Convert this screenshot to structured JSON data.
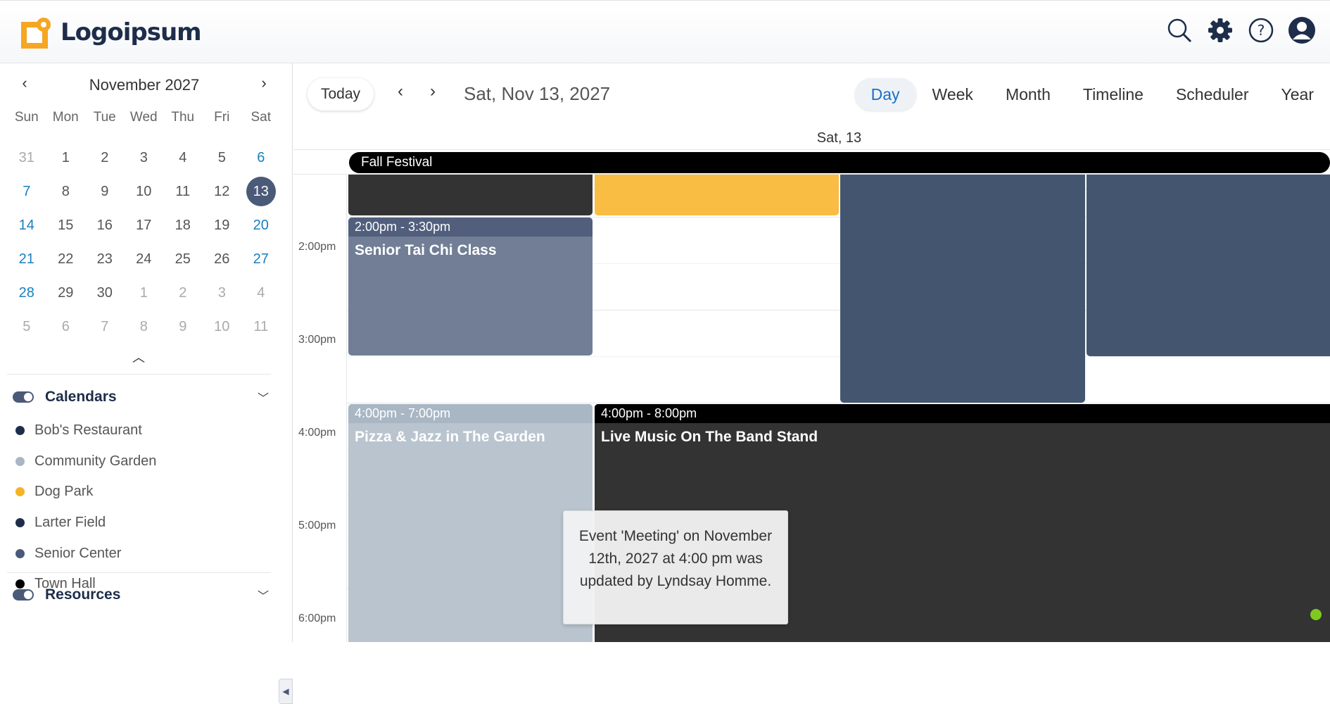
{
  "header": {
    "logo_text": "Logoipsum",
    "icons": [
      "search-icon",
      "gear-icon",
      "help-icon",
      "user-avatar-icon"
    ]
  },
  "mini_calendar": {
    "month_title": "November 2027",
    "weekdays": [
      "Sun",
      "Mon",
      "Tue",
      "Wed",
      "Thu",
      "Fri",
      "Sat"
    ],
    "days": [
      [
        "31",
        "1",
        "2",
        "3",
        "4",
        "5",
        "6"
      ],
      [
        "7",
        "8",
        "9",
        "10",
        "11",
        "12",
        "13"
      ],
      [
        "14",
        "15",
        "16",
        "17",
        "18",
        "19",
        "20"
      ],
      [
        "21",
        "22",
        "23",
        "24",
        "25",
        "26",
        "27"
      ],
      [
        "28",
        "29",
        "30",
        "1",
        "2",
        "3",
        "4"
      ],
      [
        "5",
        "6",
        "7",
        "8",
        "9",
        "10",
        "11"
      ]
    ],
    "selected": "13"
  },
  "calendars": {
    "title": "Calendars",
    "items": [
      {
        "label": "Bob's Restaurant",
        "color": "#1d2d4a"
      },
      {
        "label": "Community Garden",
        "color": "#a9b6c4"
      },
      {
        "label": "Dog Park",
        "color": "#f5b325"
      },
      {
        "label": "Larter Field",
        "color": "#1d2d4a"
      },
      {
        "label": "Senior Center",
        "color": "#4a5a78"
      },
      {
        "label": "Town Hall",
        "color": "#000000"
      }
    ]
  },
  "resources": {
    "title": "Resources"
  },
  "toolbar": {
    "today_label": "Today",
    "current_date": "Sat, Nov 13, 2027",
    "views": [
      "Day",
      "Week",
      "Month",
      "Timeline",
      "Scheduler",
      "Year"
    ],
    "active_view": "Day"
  },
  "day_header": "Sat, 13",
  "all_day_event": "Fall Festival",
  "time_labels": [
    "2:00pm",
    "3:00pm",
    "4:00pm",
    "5:00pm",
    "6:00pm"
  ],
  "events": [
    {
      "id": "tai-chi",
      "time": "2:00pm - 3:30pm",
      "title": "Senior Tai Chi Class",
      "color": "#717e96",
      "header_color": "#515f7d"
    },
    {
      "id": "pizza-jazz",
      "time": "4:00pm - 7:00pm",
      "title": "Pizza & Jazz in The Garden",
      "color": "#b9c4cf",
      "header_color": "#a9b6c4"
    },
    {
      "id": "live-music",
      "time": "4:00pm - 8:00pm",
      "title": "Live Music On The Band Stand",
      "color": "#333333",
      "header_color": "#000000"
    }
  ],
  "toast": {
    "message": "Event 'Meeting' on November 12th, 2027 at 4:00 pm was updated by Lyndsay Homme."
  }
}
